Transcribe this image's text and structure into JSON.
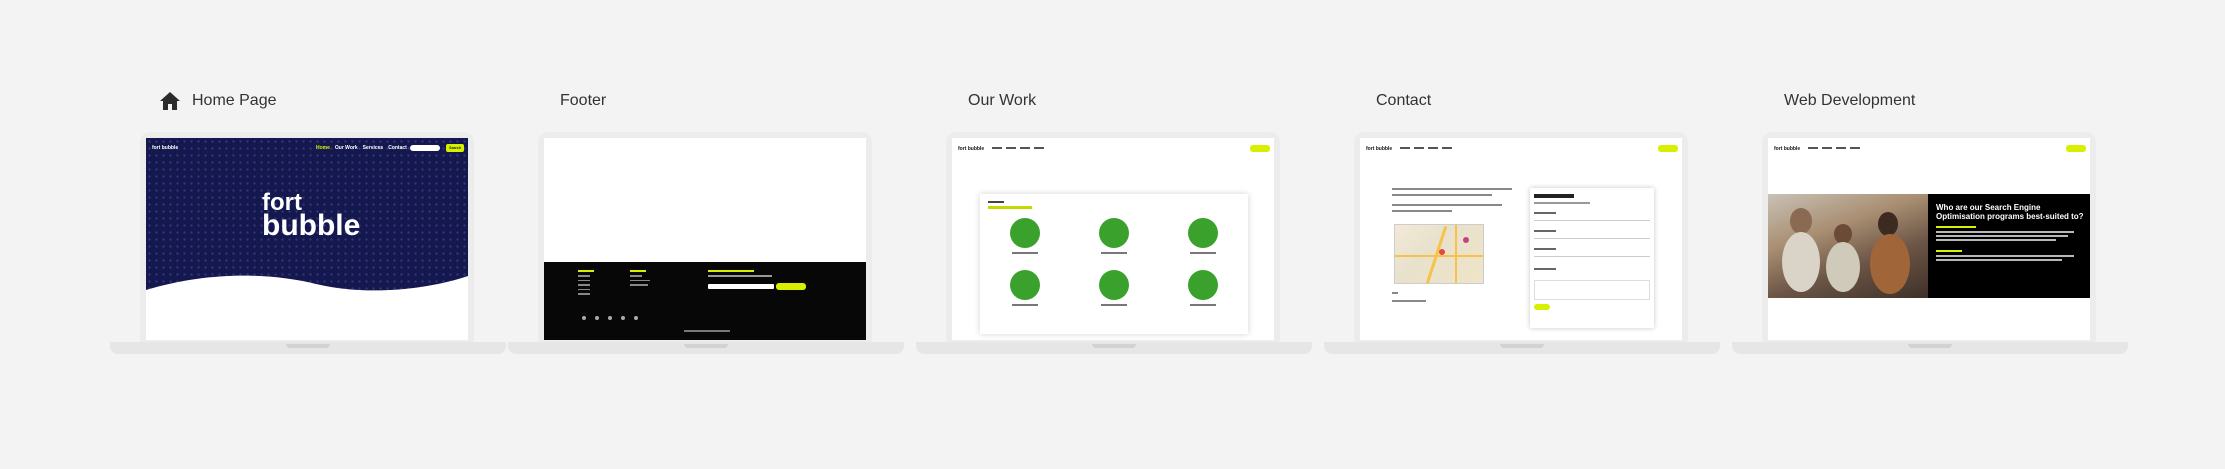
{
  "cards": [
    {
      "title": "Home Page",
      "has_icon": true,
      "icon": "home-icon",
      "screen": {
        "logo": "fort bubble",
        "nav": [
          "Home",
          "Our Work",
          "Services",
          "Contact"
        ],
        "active_nav": "Home",
        "cta": "Search",
        "hero_logo_line1": "fort",
        "hero_logo_line2": "bubble"
      }
    },
    {
      "title": "Footer"
    },
    {
      "title": "Our Work",
      "screen": {
        "logo": "fort bubble"
      }
    },
    {
      "title": "Contact",
      "screen": {
        "logo": "fort bubble"
      }
    },
    {
      "title": "Web Development",
      "screen": {
        "logo": "fort bubble",
        "heading": "Who are our Search Engine Optimisation programs best-suited to?"
      }
    }
  ],
  "colors": {
    "background": "#f3f3f3",
    "accent": "#d8f000",
    "hero": "#14184f",
    "work_green": "#3aa22c"
  }
}
